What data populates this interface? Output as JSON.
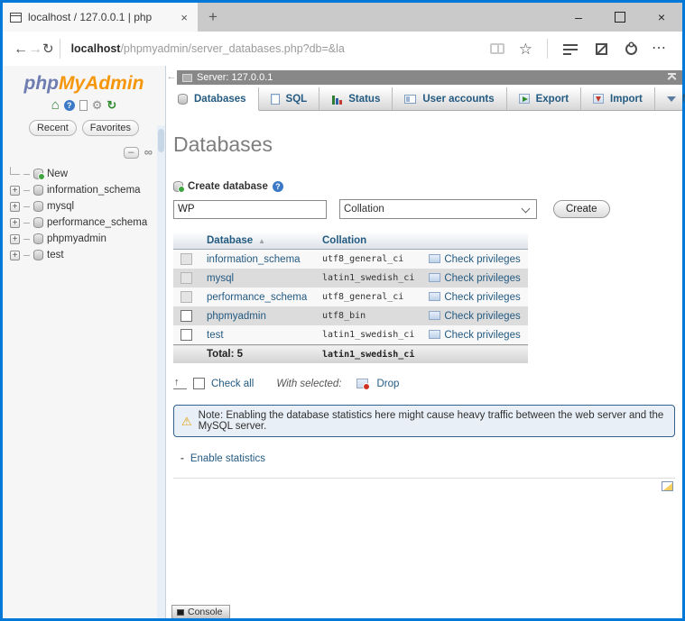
{
  "browser": {
    "tab": {
      "title": "localhost / 127.0.0.1 | php",
      "close_glyph": "×"
    },
    "new_tab_glyph": "+",
    "url": {
      "host": "localhost",
      "path": "/phpmyadmin/server_databases.php?db=&la"
    },
    "toolbar_left": [
      {
        "name": "back-icon",
        "glyph": "←"
      },
      {
        "name": "forward-icon",
        "glyph": "→"
      },
      {
        "name": "refresh-icon",
        "glyph": "↻"
      }
    ],
    "toolbar_right": [
      {
        "name": "reading-view-icon"
      },
      {
        "name": "favorites-star-icon",
        "glyph": "☆"
      },
      {
        "name": "toolbar-divider"
      },
      {
        "name": "hub-icon"
      },
      {
        "name": "web-note-icon"
      },
      {
        "name": "share-icon"
      },
      {
        "name": "more-icon",
        "glyph": "⋯"
      }
    ],
    "window_controls": [
      {
        "name": "minimize-button",
        "glyph": "–"
      },
      {
        "name": "maximize-button",
        "glyph": ""
      },
      {
        "name": "close-button",
        "glyph": "×"
      }
    ]
  },
  "sidebar": {
    "logo": {
      "php": "php",
      "rest": "MyAdmin"
    },
    "toolbar": [
      {
        "name": "home-icon"
      },
      {
        "name": "help-icon"
      },
      {
        "name": "doc-icon"
      },
      {
        "name": "gear-icon"
      },
      {
        "name": "refresh-nav-icon"
      }
    ],
    "filters": [
      {
        "label": "Recent"
      },
      {
        "label": "Favorites"
      }
    ],
    "panel_buttons": [
      {
        "name": "collapse-all-icon"
      },
      {
        "name": "unlink-icon"
      }
    ],
    "tree": [
      {
        "label": "New",
        "icon": "database-new-icon",
        "expandable": false
      },
      {
        "label": "information_schema",
        "icon": "database-icon",
        "expandable": true
      },
      {
        "label": "mysql",
        "icon": "database-icon",
        "expandable": true
      },
      {
        "label": "performance_schema",
        "icon": "database-icon",
        "expandable": true
      },
      {
        "label": "phpmyadmin",
        "icon": "database-icon",
        "expandable": true
      },
      {
        "label": "test",
        "icon": "database-icon",
        "expandable": true
      }
    ]
  },
  "main": {
    "server_label": "Server: 127.0.0.1",
    "tabs": [
      {
        "label": "Databases",
        "icon": "database-icon",
        "active": true
      },
      {
        "label": "SQL",
        "icon": "sql-icon",
        "active": false
      },
      {
        "label": "Status",
        "icon": "status-icon",
        "active": false
      },
      {
        "label": "User accounts",
        "icon": "user-accounts-icon",
        "active": false
      },
      {
        "label": "Export",
        "icon": "export-icon",
        "active": false
      },
      {
        "label": "Import",
        "icon": "import-icon",
        "active": false
      },
      {
        "label": "More",
        "icon": "caret-down-icon",
        "active": false
      }
    ],
    "heading": "Databases",
    "create": {
      "label": "Create database",
      "input_value": "WP",
      "collation_value": "Collation",
      "button_label": "Create"
    },
    "table": {
      "headers": [
        "Database",
        "Collation"
      ],
      "rows": [
        {
          "database": "information_schema",
          "collation": "utf8_general_ci",
          "action": "Check privileges",
          "checkbox_disabled": true,
          "shaded": false
        },
        {
          "database": "mysql",
          "collation": "latin1_swedish_ci",
          "action": "Check privileges",
          "checkbox_disabled": true,
          "shaded": true
        },
        {
          "database": "performance_schema",
          "collation": "utf8_general_ci",
          "action": "Check privileges",
          "checkbox_disabled": true,
          "shaded": false
        },
        {
          "database": "phpmyadmin",
          "collation": "utf8_bin",
          "action": "Check privileges",
          "checkbox_disabled": false,
          "shaded": true
        },
        {
          "database": "test",
          "collation": "latin1_swedish_ci",
          "action": "Check privileges",
          "checkbox_disabled": false,
          "shaded": false
        }
      ],
      "footer": {
        "total": "Total: 5",
        "collation": "latin1_swedish_ci"
      }
    },
    "bulk": {
      "check_all": "Check all",
      "with_selected": "With selected:",
      "drop": "Drop"
    },
    "note": "Note: Enabling the database statistics here might cause heavy traffic between the web server and the MySQL server.",
    "enable_statistics": "Enable statistics",
    "console": "Console"
  },
  "colors": {
    "accent": "#0078d7",
    "link": "#235a81",
    "logo_orange": "#f6960b",
    "logo_slate": "#6e7cb0",
    "note_border": "#35618f",
    "note_bg": "#e9eff7"
  }
}
